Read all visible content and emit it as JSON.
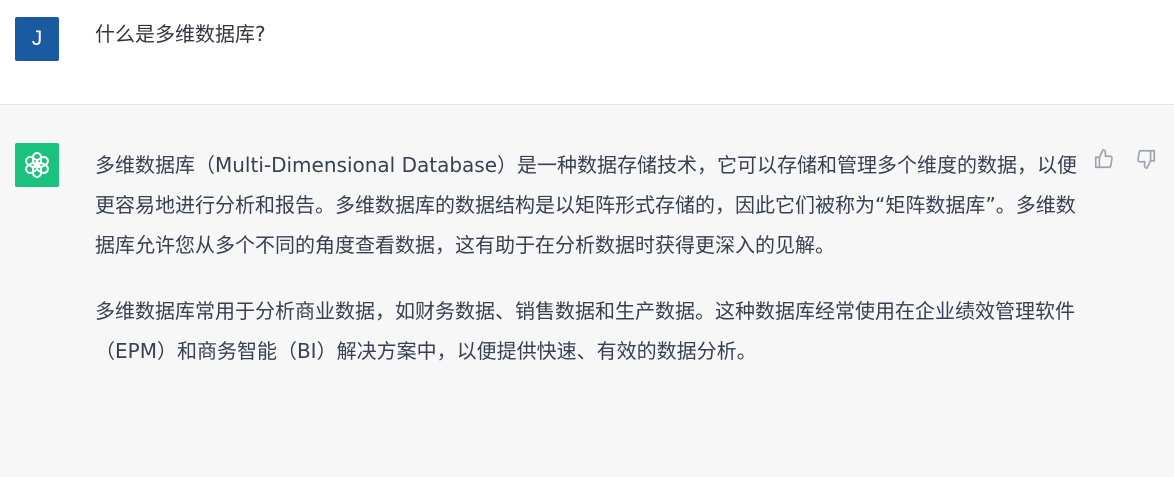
{
  "user_message": {
    "avatar_initial": "J",
    "text": "什么是多维数据库?"
  },
  "assistant_message": {
    "paragraphs": [
      "多维数据库（Multi-Dimensional Database）是一种数据存储技术，它可以存储和管理多个维度的数据，以便更容易地进行分析和报告。多维数据库的数据结构是以矩阵形式存储的，因此它们被称为“矩阵数据库”。多维数据库允许您从多个不同的角度查看数据，这有助于在分析数据时获得更深入的见解。",
      "多维数据库常用于分析商业数据，如财务数据、销售数据和生产数据。这种数据库经常使用在企业绩效管理软件（EPM）和商务智能（BI）解决方案中，以便提供快速、有效的数据分析。"
    ]
  },
  "icons": {
    "assistant_avatar": "openai-logo-icon",
    "thumbs_up": "thumbs-up-icon",
    "thumbs_down": "thumbs-down-icon"
  },
  "colors": {
    "user_avatar_bg": "#1a5aa0",
    "assistant_avatar_bg": "#19c37d",
    "assistant_row_bg": "#f7f7f8",
    "text": "#374151"
  }
}
